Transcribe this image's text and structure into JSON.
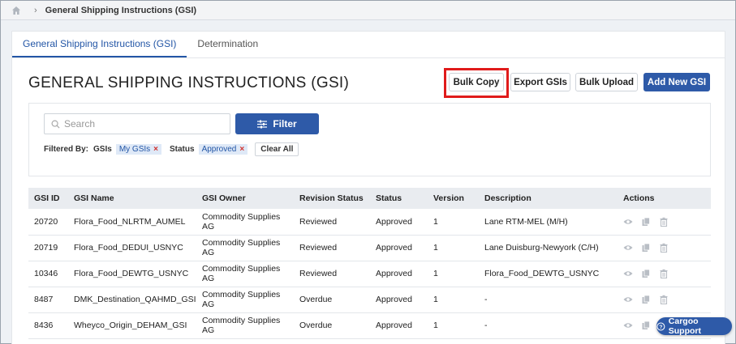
{
  "breadcrumb": {
    "title": "General Shipping Instructions (GSI)",
    "separator": "›"
  },
  "tabs": [
    {
      "label": "General Shipping Instructions (GSI)",
      "active": true
    },
    {
      "label": "Determination",
      "active": false
    }
  ],
  "page": {
    "title": "GENERAL SHIPPING INSTRUCTIONS (GSI)"
  },
  "toolbar": {
    "bulk_copy": "Bulk Copy",
    "export": "Export GSIs",
    "bulk_upload": "Bulk Upload",
    "add_new": "Add New GSI"
  },
  "search": {
    "placeholder": "Search",
    "value": ""
  },
  "filter": {
    "button": "Filter",
    "filtered_by": "Filtered By:",
    "gsis_label": "GSIs",
    "gsis_chip": "My GSIs",
    "status_label": "Status",
    "status_chip": "Approved",
    "clear_all": "Clear All"
  },
  "table": {
    "headers": [
      "GSI ID",
      "GSI Name",
      "GSI Owner",
      "Revision Status",
      "Status",
      "Version",
      "Description",
      "Actions"
    ],
    "rows": [
      {
        "id": "20720",
        "name": "Flora_Food_NLRTM_AUMEL",
        "owner": "Commodity Supplies AG",
        "revision": "Reviewed",
        "status": "Approved",
        "version": "1",
        "description": "Lane RTM-MEL (M/H)"
      },
      {
        "id": "20719",
        "name": "Flora_Food_DEDUI_USNYC",
        "owner": "Commodity Supplies AG",
        "revision": "Reviewed",
        "status": "Approved",
        "version": "1",
        "description": "Lane Duisburg-Newyork (C/H)"
      },
      {
        "id": "10346",
        "name": "Flora_Food_DEWTG_USNYC",
        "owner": "Commodity Supplies AG",
        "revision": "Reviewed",
        "status": "Approved",
        "version": "1",
        "description": "Flora_Food_DEWTG_USNYC"
      },
      {
        "id": "8487",
        "name": "DMK_Destination_QAHMD_GSI",
        "owner": "Commodity Supplies AG",
        "revision": "Overdue",
        "status": "Approved",
        "version": "1",
        "description": "-"
      },
      {
        "id": "8436",
        "name": "Wheyco_Origin_DEHAM_GSI",
        "owner": "Commodity Supplies AG",
        "revision": "Overdue",
        "status": "Approved",
        "version": "1",
        "description": "-"
      }
    ]
  },
  "support": {
    "label": "Cargoo Support"
  },
  "colors": {
    "primary": "#2e5aa8",
    "reviewed": "#5fbf9b",
    "overdue": "#d0312d",
    "highlight": "#e01b1b"
  },
  "icons": [
    "home-icon",
    "search-icon",
    "filter-sliders-icon",
    "eye-icon",
    "copy-icon",
    "trash-icon",
    "help-circle-icon"
  ]
}
